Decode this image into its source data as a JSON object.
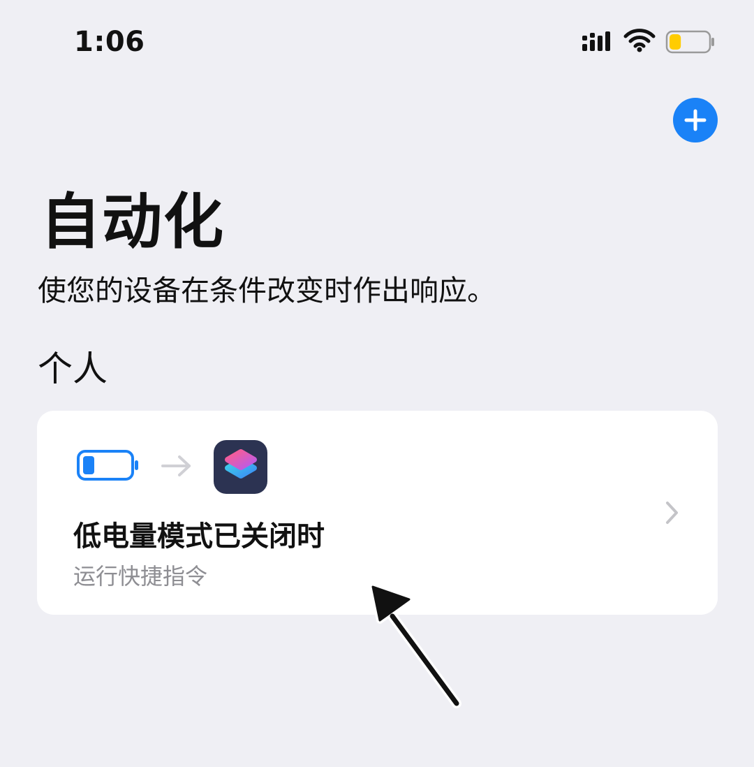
{
  "status_bar": {
    "time": "1:06",
    "signal_icon": "cellular-signal-icon",
    "wifi_icon": "wifi-icon",
    "battery_icon": "battery-icon",
    "battery_level_fraction": 0.3,
    "battery_color": "#ffcc00"
  },
  "toolbar": {
    "add_icon": "plus-icon",
    "accent_color": "#1a82f7"
  },
  "header": {
    "title": "自动化",
    "subtitle": "使您的设备在条件改变时作出响应。"
  },
  "section": {
    "title": "个人"
  },
  "automation": {
    "trigger_icon": "battery-icon",
    "arrow_icon": "arrow-right-icon",
    "action_app_icon": "shortcuts-app-icon",
    "title": "低电量模式已关闭时",
    "subtitle": "运行快捷指令",
    "chevron_icon": "chevron-right-icon",
    "trigger_color": "#1a82f7"
  },
  "annotation": {
    "icon": "pointer-arrow-icon"
  }
}
